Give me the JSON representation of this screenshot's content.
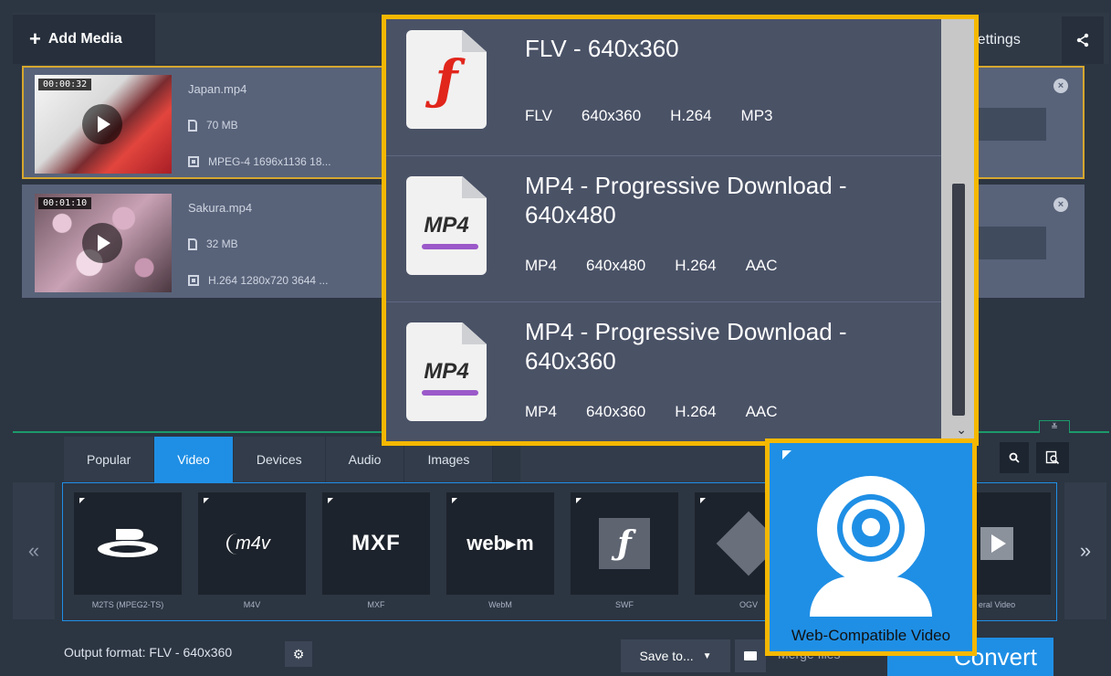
{
  "header": {
    "add_media_label": "Add Media",
    "settings_label": "Settings"
  },
  "files": [
    {
      "timecode": "00:00:32",
      "name": "Japan.mp4",
      "size": "70 MB",
      "meta": "MPEG-4 1696x1136 18..."
    },
    {
      "timecode": "00:01:10",
      "name": "Sakura.mp4",
      "size": "32 MB",
      "meta": "H.264 1280x720 3644 ..."
    }
  ],
  "format_tabs": [
    "Popular",
    "Video",
    "Devices",
    "Audio",
    "Images"
  ],
  "active_tab": "Video",
  "format_cards": [
    {
      "label": "M2TS (MPEG2-TS)",
      "logo": "bluray-icon"
    },
    {
      "label": "M4V",
      "logo": "m4v"
    },
    {
      "label": "MXF",
      "logo": "MXF"
    },
    {
      "label": "WebM",
      "logo": "web▸m"
    },
    {
      "label": "SWF",
      "logo": "flash-icon"
    },
    {
      "label": "OGV",
      "logo": "ogv-icon"
    },
    {
      "label": "eral Video",
      "logo": "general-video-icon"
    }
  ],
  "nav": {
    "prev": "«",
    "next": "»"
  },
  "popup": {
    "items": [
      {
        "title": "FLV - 640x360",
        "specs": [
          "FLV",
          "640x360",
          "H.264",
          "MP3"
        ],
        "icon": "flash-file-icon"
      },
      {
        "title": "MP4 - Progressive Download - 640x480",
        "specs": [
          "MP4",
          "640x480",
          "H.264",
          "AAC"
        ],
        "icon": "mp4-file-icon",
        "badge": "MP4"
      },
      {
        "title": "MP4 - Progressive Download - 640x360",
        "specs": [
          "MP4",
          "640x360",
          "H.264",
          "AAC"
        ],
        "icon": "mp4-file-icon",
        "badge": "MP4"
      }
    ]
  },
  "highlight_card": {
    "label": "Web-Compatible Video",
    "icon": "webcam-icon"
  },
  "bottom": {
    "output_format": "Output format: FLV - 640x360",
    "save_to": "Save to...",
    "merge": "Merge files",
    "convert": "Convert"
  },
  "colors": {
    "accent": "#1f8fe5",
    "highlight_border": "#f5b800",
    "panel_border": "#1c9a6a"
  }
}
